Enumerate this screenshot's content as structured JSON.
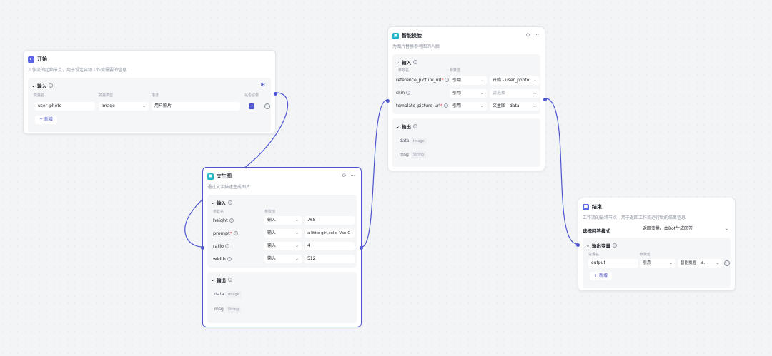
{
  "colors": {
    "accent": "#4e55cf",
    "start_icon": "#5b63e6",
    "text_to_image_icon": "#23b7c9",
    "swap_icon": "#23b7c9",
    "end_icon": "#5b63e6"
  },
  "nodes": {
    "start": {
      "icon": "start-icon",
      "title": "开始",
      "desc": "工作流的起始节点，用于设定启动工作流需要的信息",
      "input_title": "输入",
      "col_var": "变量名",
      "col_type": "变量类型",
      "col_desc": "描述",
      "col_required": "是否必要",
      "row": {
        "name": "user_photo",
        "type": "Image",
        "desc": "用户照片"
      },
      "add_label": "新增"
    },
    "text_to_image": {
      "icon": "image-icon",
      "title": "文生图",
      "desc": "通过文字描述生成图片",
      "input_title": "输入",
      "col_param": "参数名",
      "col_value": "参数值",
      "params": [
        {
          "name": "height",
          "required": "",
          "mode": "输入",
          "value": "768"
        },
        {
          "name": "prompt",
          "required": "*",
          "mode": "输入",
          "value": "a little girl,solo, Van G"
        },
        {
          "name": "ratio",
          "required": "",
          "mode": "输入",
          "value": "4"
        },
        {
          "name": "width",
          "required": "",
          "mode": "输入",
          "value": "512"
        }
      ],
      "output_title": "输出",
      "outputs": [
        {
          "name": "data",
          "type": "Image"
        },
        {
          "name": "msg",
          "type": "String"
        }
      ]
    },
    "face_swap": {
      "icon": "swap-icon",
      "title": "智能换脸",
      "desc": "为图片替换参考图的人脸",
      "input_title": "输入",
      "col_param": "参数名",
      "col_value": "参数值",
      "params": [
        {
          "name": "reference_picture_url",
          "required": "*",
          "mode": "引用",
          "value": "开始 - user_photo"
        },
        {
          "name": "skin",
          "required": "",
          "mode": "引用",
          "value": "请选择"
        },
        {
          "name": "template_picture_url",
          "required": "*",
          "mode": "引用",
          "value": "文生图 - data"
        }
      ],
      "output_title": "输出",
      "outputs": [
        {
          "name": "data",
          "type": "Image"
        },
        {
          "name": "msg",
          "type": "String"
        }
      ]
    },
    "end": {
      "icon": "end-icon",
      "title": "结束",
      "desc": "工作流的最终节点，用于返回工作流运行后的结果信息",
      "mode_label": "选择回答模式",
      "mode_value": "返回变量，由Bot生成回答",
      "output_title": "输出变量",
      "col_var": "变量名",
      "col_value": "参数值",
      "row": {
        "name": "output",
        "mode": "引用",
        "value": "智能换脸 - d..."
      },
      "add_label": "新增"
    }
  }
}
